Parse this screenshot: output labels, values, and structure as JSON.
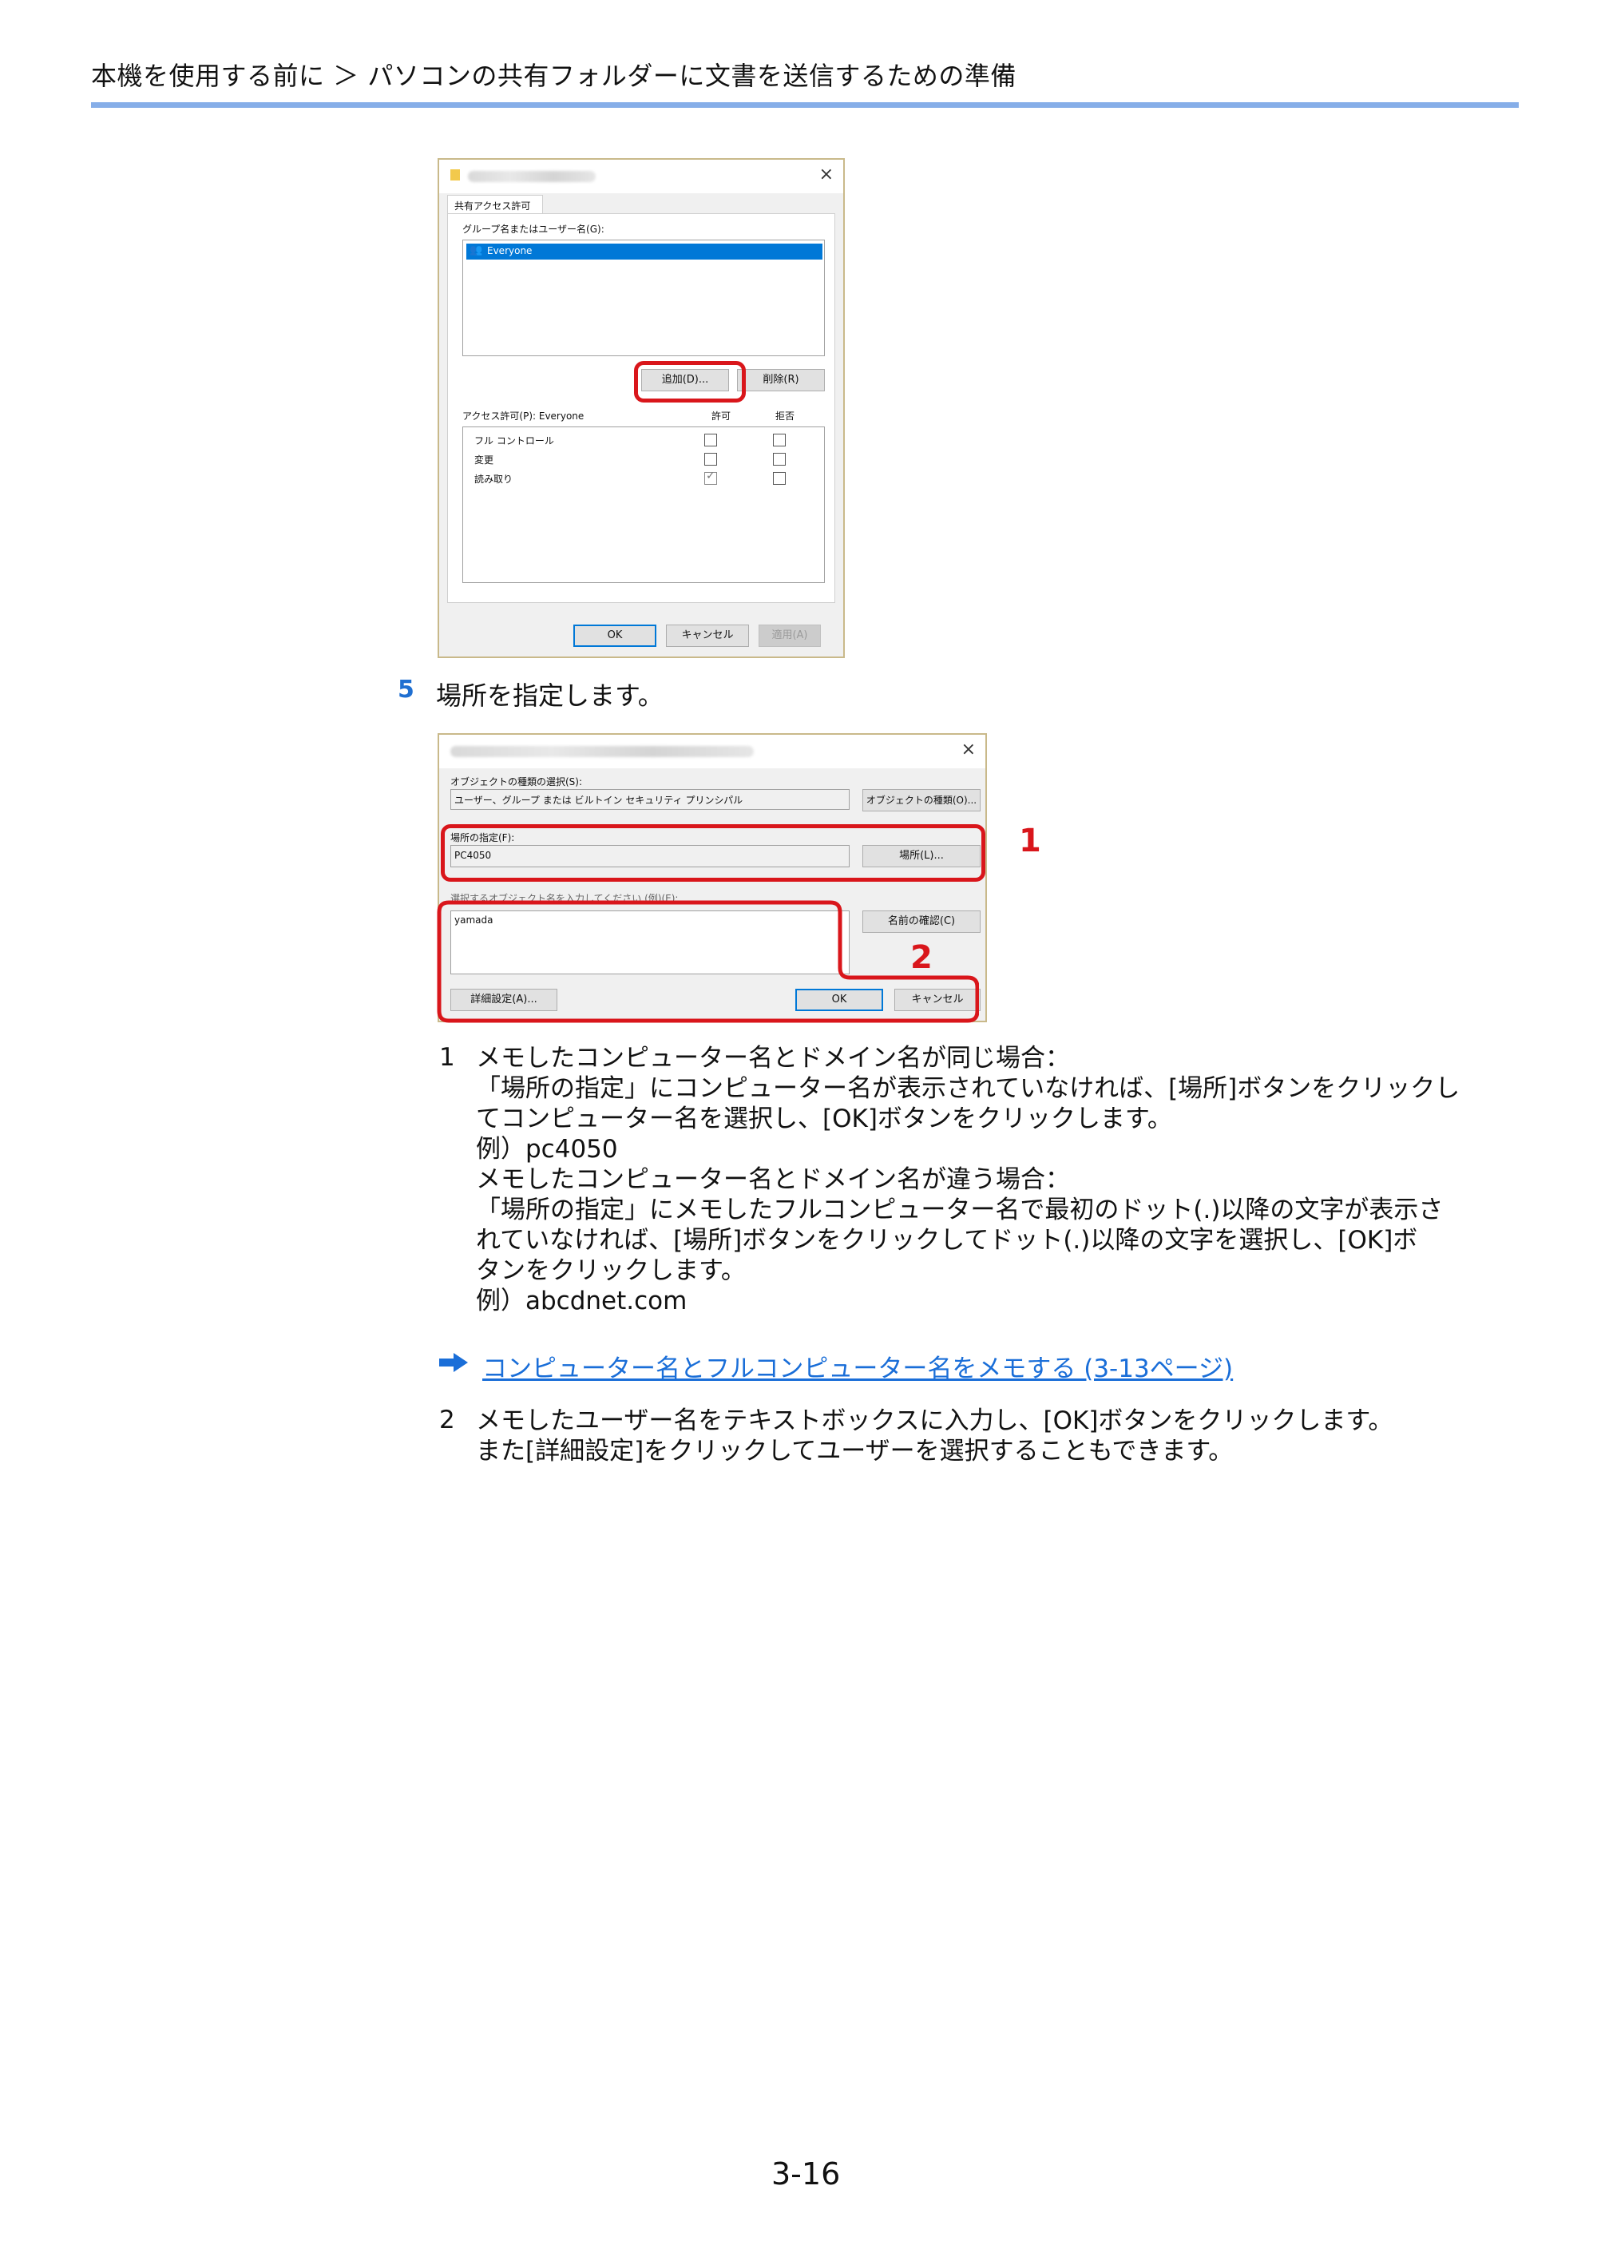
{
  "header": {
    "title": "本機を使用する前に ＞ パソコンの共有フォルダーに文書を送信するための準備"
  },
  "dialog1": {
    "tab": "共有アクセス許可",
    "group_label": "グループ名またはユーザー名(G):",
    "selected_user": "Everyone",
    "add_button": "追加(D)...",
    "remove_button": "削除(R)",
    "permissions_label": "アクセス許可(P): Everyone",
    "col_allow": "許可",
    "col_deny": "拒否",
    "permissions": [
      {
        "name": "フル コントロール",
        "allow": false,
        "deny": false
      },
      {
        "name": "変更",
        "allow": false,
        "deny": false
      },
      {
        "name": "読み取り",
        "allow": true,
        "deny": false
      }
    ],
    "ok": "OK",
    "cancel": "キャンセル",
    "apply": "適用(A)"
  },
  "step5": {
    "number": "5",
    "text": "場所を指定します。"
  },
  "dialog2": {
    "object_type_label": "オブジェクトの種類の選択(S):",
    "object_type_value": "ユーザー、グループ または ビルトイン セキュリティ プリンシパル",
    "object_type_button": "オブジェクトの種類(O)...",
    "location_label": "場所の指定(F):",
    "location_value": "PC4050",
    "location_button": "場所(L)...",
    "names_label": "選択するオブジェクト名を入力してください (例)(E):",
    "names_value": "yamada",
    "check_names_button": "名前の確認(C)",
    "advanced_button": "詳細設定(A)...",
    "ok": "OK",
    "cancel": "キャンセル",
    "callout1": "1",
    "callout2": "2"
  },
  "instructions": {
    "item1_num": "1",
    "item1_lines": [
      "メモしたコンピューター名とドメイン名が同じ場合：",
      "「場所の指定」にコンピューター名が表示されていなければ、[場所]ボタンをクリックし",
      "てコンピューター名を選択し、[OK]ボタンをクリックします。",
      "例）pc4050",
      "メモしたコンピューター名とドメイン名が違う場合：",
      "「場所の指定」にメモしたフルコンピューター名で最初のドット(.)以降の文字が表示さ",
      "れていなければ、[場所]ボタンをクリックしてドット(.)以降の文字を選択し、[OK]ボ",
      "タンをクリックします。",
      "例）abcdnet.com"
    ],
    "link_text": "コンピューター名とフルコンピューター名をメモする (3-13ページ)",
    "item2_num": "2",
    "item2_lines": [
      "メモしたユーザー名をテキストボックスに入力し、[OK]ボタンをクリックします。",
      "また[詳細設定]をクリックしてユーザーを選択することもできます。"
    ]
  },
  "footer": {
    "page_number": "3-16"
  },
  "colors": {
    "accent_blue": "#1a6ed8",
    "highlight_red": "#d9161b",
    "header_rule": "#86aee8"
  }
}
